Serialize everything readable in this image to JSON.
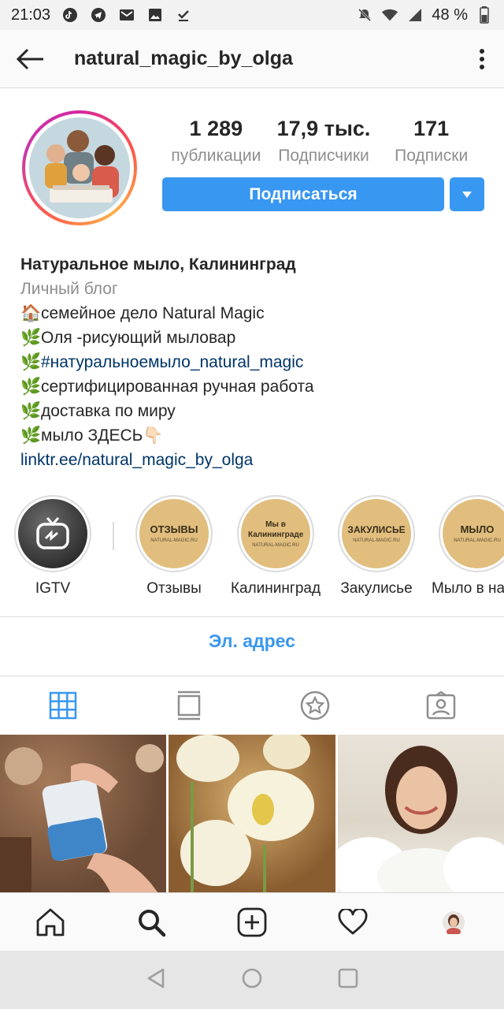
{
  "status_bar": {
    "time": "21:03",
    "battery": "48 %",
    "left_icons": [
      "tiktok-icon",
      "telegram-icon",
      "gmail-icon",
      "gallery-icon",
      "download-done-icon"
    ],
    "right_icons": [
      "mute-icon",
      "wifi-icon",
      "signal-icon",
      "battery-icon"
    ]
  },
  "header": {
    "username": "natural_magic_by_olga"
  },
  "stats": [
    {
      "value": "1 289",
      "label": "публикации"
    },
    {
      "value": "17,9 тыс.",
      "label": "Подписчики"
    },
    {
      "value": "171",
      "label": "Подписки"
    }
  ],
  "actions": {
    "follow_label": "Подписаться"
  },
  "bio": {
    "name": "Натуральное мыло, Калининград",
    "category": "Личный блог",
    "lines": [
      {
        "emoji": "🏠",
        "text": "семейное дело Natural Magic"
      },
      {
        "emoji": "🌿",
        "text": "Оля -рисующий мыловар"
      },
      {
        "emoji": "🌿",
        "text": " #натуральноемыло_natural_magic"
      },
      {
        "emoji": "🌿",
        "text": "сертифицированная ручная работа"
      },
      {
        "emoji": "🌿",
        "text": "доставка по миру"
      },
      {
        "emoji": "🌿",
        "text": "мыло ЗДЕСЬ👇🏻"
      }
    ],
    "link": "linktr.ee/natural_magic_by_olga"
  },
  "highlights": [
    {
      "label": "IGTV",
      "title": "",
      "sub": ""
    },
    {
      "label": "Отзывы",
      "title": "ОТЗЫВЫ",
      "sub": "NATURAL-MAGIC.RU"
    },
    {
      "label": "Калининград",
      "title": "Мы в Калининграде",
      "sub": "NATURAL-MAGIC.RU"
    },
    {
      "label": "Закулисье",
      "title": "ЗАКУЛИСЬЕ",
      "sub": "NATURAL-MAGIC.RU"
    },
    {
      "label": "Мыло в на",
      "title": "МЫЛО",
      "sub": "NATURAL-MAGIC.RU"
    }
  ],
  "contact": {
    "email_label": "Эл. адрес"
  },
  "colors": {
    "accent": "#3897f0",
    "link": "#003569",
    "highlight_fill": "#e1be7e"
  }
}
